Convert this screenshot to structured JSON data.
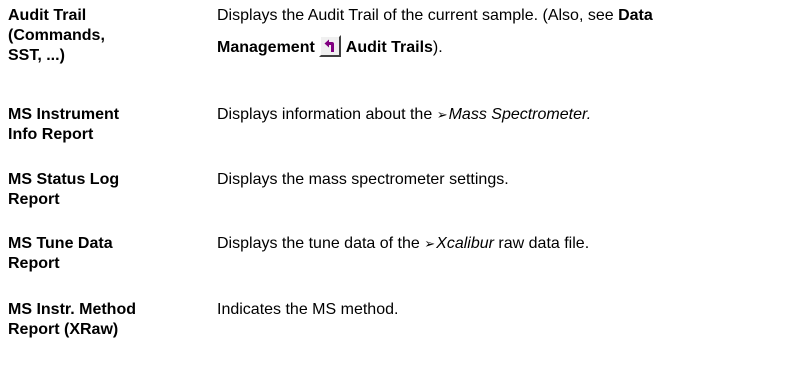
{
  "entries": [
    {
      "term_lines": [
        "Audit Trail",
        "(Commands,",
        "SST, ...)"
      ],
      "desc_prefix": "Displays the Audit Trail of the current sample. (Also, see",
      "link_part1": "Data",
      "link_part2": "Management",
      "link_part3": "Audit Trails",
      "desc_suffix": ").",
      "icon": "jump-arrow-icon"
    },
    {
      "term_lines": [
        "MS Instrument",
        "Info Report"
      ],
      "desc_prefix": "Displays information about the",
      "glossary_marker": "➢",
      "glossary_term": "Mass Spectrometer",
      "desc_suffix": "."
    },
    {
      "term_lines": [
        "MS Status Log",
        "Report"
      ],
      "desc": "Displays the mass spectrometer settings."
    },
    {
      "term_lines": [
        "MS Tune Data",
        "Report"
      ],
      "desc_prefix": "Displays the tune data of the",
      "glossary_marker": "➢",
      "glossary_term": "Xcalibur",
      "desc_suffix": "raw data file."
    },
    {
      "term_lines": [
        "MS Instr. Method",
        "Report (XRaw)"
      ],
      "desc": "Indicates the MS method."
    }
  ],
  "colors": {
    "text": "#000000",
    "icon_bg": "#f0f0f0",
    "icon_arrow": "#800080"
  }
}
